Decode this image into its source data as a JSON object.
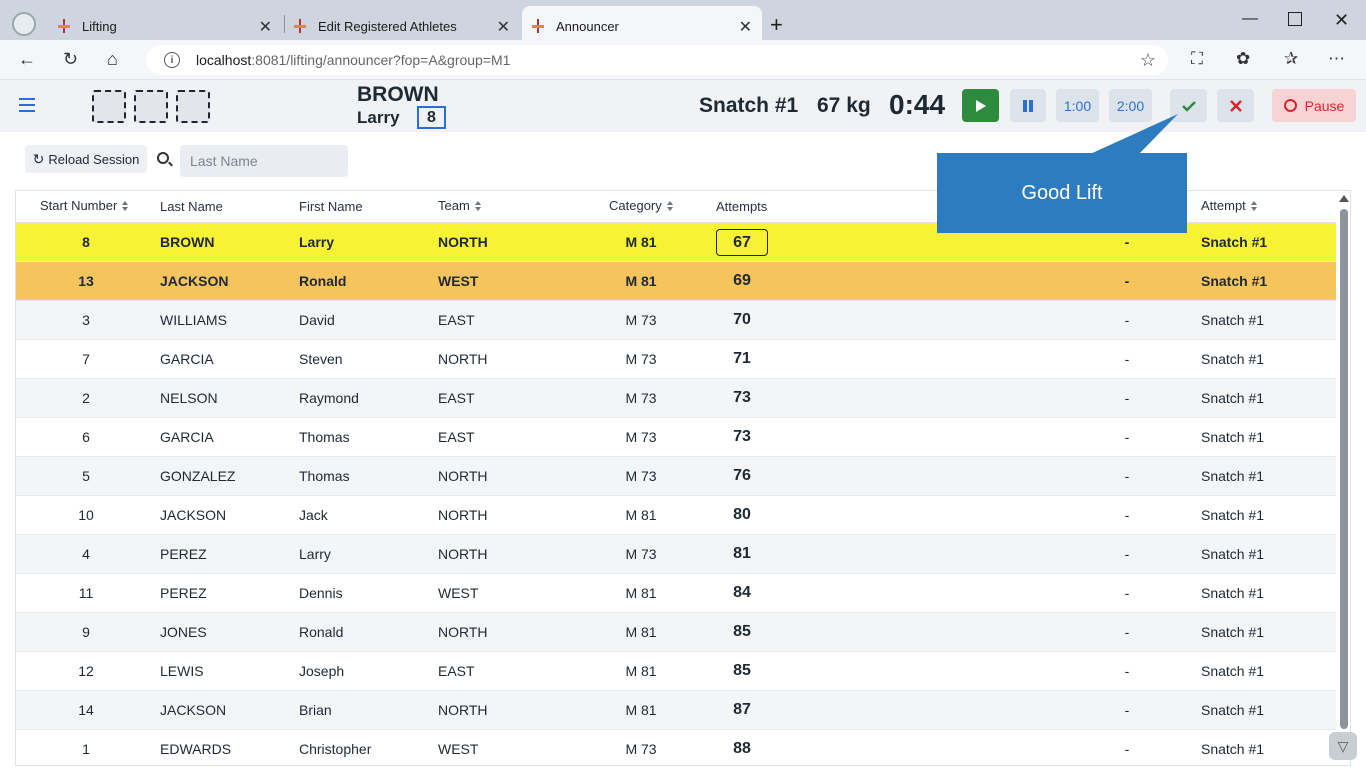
{
  "browser": {
    "tabs": [
      {
        "title": "Lifting"
      },
      {
        "title": "Edit Registered Athletes"
      },
      {
        "title": "Announcer"
      }
    ],
    "url_host": "localhost",
    "url_path": ":8081/lifting/announcer?fop=A&group=M1"
  },
  "header": {
    "lifter_last_name": "BROWN",
    "lifter_first_name": "Larry",
    "start_number": "8",
    "attempt": "Snatch #1",
    "weight": "67 kg",
    "clock": "0:44",
    "btn_1min": "1:00",
    "btn_2min": "2:00",
    "pause_label": "Pause"
  },
  "toolbar": {
    "reload_label": "Reload Session",
    "search_placeholder": "Last Name"
  },
  "tooltip": {
    "text": "Good Lift"
  },
  "grid": {
    "columns": {
      "start": "Start Number",
      "last": "Last Name",
      "first": "First Name",
      "team": "Team",
      "category": "Category",
      "attempts": "Attempts",
      "attempt": "Attempt"
    },
    "rows": [
      {
        "start": "8",
        "last": "BROWN",
        "first": "Larry",
        "team": "NORTH",
        "cat": "M 81",
        "att": "67",
        "dash": "-",
        "attempt": "Snatch #1"
      },
      {
        "start": "13",
        "last": "JACKSON",
        "first": "Ronald",
        "team": "WEST",
        "cat": "M 81",
        "att": "69",
        "dash": "-",
        "attempt": "Snatch #1"
      },
      {
        "start": "3",
        "last": "WILLIAMS",
        "first": "David",
        "team": "EAST",
        "cat": "M 73",
        "att": "70",
        "dash": "-",
        "attempt": "Snatch #1"
      },
      {
        "start": "7",
        "last": "GARCIA",
        "first": "Steven",
        "team": "NORTH",
        "cat": "M 73",
        "att": "71",
        "dash": "-",
        "attempt": "Snatch #1"
      },
      {
        "start": "2",
        "last": "NELSON",
        "first": "Raymond",
        "team": "EAST",
        "cat": "M 73",
        "att": "73",
        "dash": "-",
        "attempt": "Snatch #1"
      },
      {
        "start": "6",
        "last": "GARCIA",
        "first": "Thomas",
        "team": "EAST",
        "cat": "M 73",
        "att": "73",
        "dash": "-",
        "attempt": "Snatch #1"
      },
      {
        "start": "5",
        "last": "GONZALEZ",
        "first": "Thomas",
        "team": "NORTH",
        "cat": "M 73",
        "att": "76",
        "dash": "-",
        "attempt": "Snatch #1"
      },
      {
        "start": "10",
        "last": "JACKSON",
        "first": "Jack",
        "team": "NORTH",
        "cat": "M 81",
        "att": "80",
        "dash": "-",
        "attempt": "Snatch #1"
      },
      {
        "start": "4",
        "last": "PEREZ",
        "first": "Larry",
        "team": "NORTH",
        "cat": "M 73",
        "att": "81",
        "dash": "-",
        "attempt": "Snatch #1"
      },
      {
        "start": "11",
        "last": "PEREZ",
        "first": "Dennis",
        "team": "WEST",
        "cat": "M 81",
        "att": "84",
        "dash": "-",
        "attempt": "Snatch #1"
      },
      {
        "start": "9",
        "last": "JONES",
        "first": "Ronald",
        "team": "NORTH",
        "cat": "M 81",
        "att": "85",
        "dash": "-",
        "attempt": "Snatch #1"
      },
      {
        "start": "12",
        "last": "LEWIS",
        "first": "Joseph",
        "team": "EAST",
        "cat": "M 81",
        "att": "85",
        "dash": "-",
        "attempt": "Snatch #1"
      },
      {
        "start": "14",
        "last": "JACKSON",
        "first": "Brian",
        "team": "NORTH",
        "cat": "M 81",
        "att": "87",
        "dash": "-",
        "attempt": "Snatch #1"
      },
      {
        "start": "1",
        "last": "EDWARDS",
        "first": "Christopher",
        "team": "WEST",
        "cat": "M 73",
        "att": "88",
        "dash": "-",
        "attempt": "Snatch #1"
      }
    ]
  },
  "colors": {
    "current_row": "#f7f234",
    "next_row": "#f5c45c",
    "accent": "#2a6fd6",
    "tooltip": "#2e7cc0"
  }
}
